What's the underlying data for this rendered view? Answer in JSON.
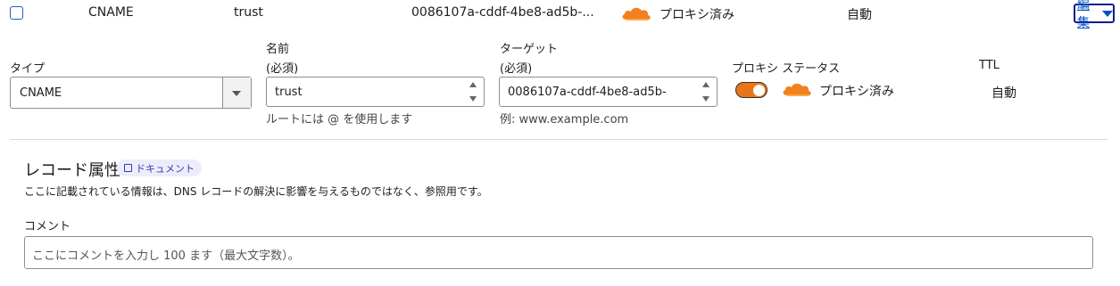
{
  "record_row": {
    "type": "CNAME",
    "name": "trust",
    "content": "0086107a-cddf-4be8-ad5b-...",
    "proxy_status": "プロキシ済み",
    "ttl": "自動",
    "edit_label": "編集"
  },
  "form": {
    "type": {
      "label": "タイプ",
      "value": "CNAME"
    },
    "name": {
      "label_line1": "名前",
      "label_line2": "(必須)",
      "value": "trust",
      "hint": "ルートには @ を使用します"
    },
    "target": {
      "label_line1": "ターゲット",
      "label_line2": "(必須)",
      "value": "0086107a-cddf-4be8-ad5b-",
      "hint": "例: www.example.com"
    },
    "proxy": {
      "label": "プロキシ ステータス",
      "status": "プロキシ済み",
      "enabled": true
    },
    "ttl": {
      "label": "TTL",
      "value": "自動"
    }
  },
  "attributes": {
    "title": "レコード属性",
    "doc_badge": "ドキュメント",
    "description": "ここに記載されている情報は、DNS レコードの解決に影響を与えるものではなく、参照用です。",
    "comment_label": "コメント",
    "comment_placeholder": "ここにコメントを入力し 100 ます（最大文字数）。"
  },
  "colors": {
    "accent_orange": "#f38020",
    "link_blue": "#0051c3"
  },
  "icons": {
    "proxy": "cloud-icon",
    "doc": "book-icon"
  }
}
